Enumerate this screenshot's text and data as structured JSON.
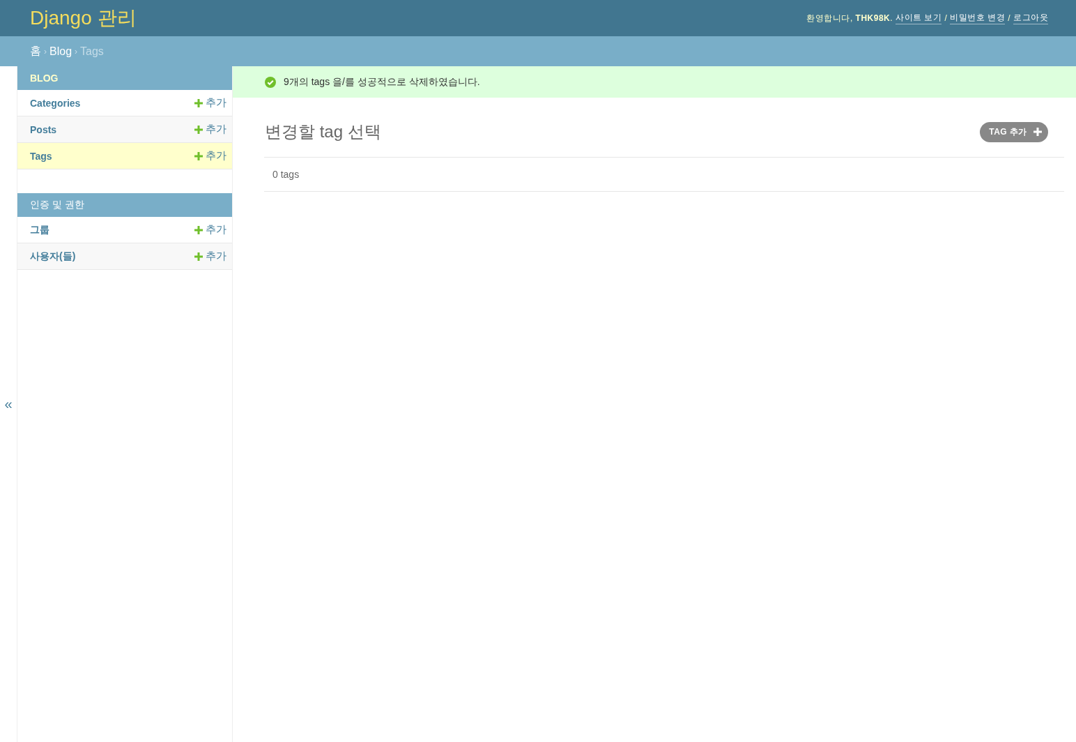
{
  "header": {
    "title": "Django 관리",
    "welcome": "환영합니다, **THK98K**.",
    "links": [
      "사이트 보기",
      "비밀번호 변경",
      "로그아웃"
    ],
    "separator": "/"
  },
  "breadcrumbs": {
    "separator": "›",
    "items": [
      {
        "label": "홈",
        "current": false
      },
      {
        "label": "Blog",
        "current": false
      },
      {
        "label": "Tags",
        "current": true
      }
    ]
  },
  "nav_toggle": "«",
  "sidebar": {
    "modules": [
      {
        "caption": "BLOG",
        "models": [
          {
            "name": "Categories",
            "add": "추가",
            "selected": false
          },
          {
            "name": "Posts",
            "add": "추가",
            "selected": false
          },
          {
            "name": "Tags",
            "add": "추가",
            "selected": true
          }
        ]
      },
      {
        "caption": "인증 및 권한",
        "models": [
          {
            "name": "그룹",
            "add": "추가",
            "selected": false
          },
          {
            "name": "사용자(들)",
            "add": "추가",
            "selected": false
          }
        ]
      }
    ]
  },
  "message": {
    "kind": "success",
    "text": "9개의 tags 을/를 성공적으로 삭제하였습니다."
  },
  "content": {
    "title": "변경할 tag 선택",
    "add_button": "TAG 추가",
    "result_count": "0 tags"
  }
}
